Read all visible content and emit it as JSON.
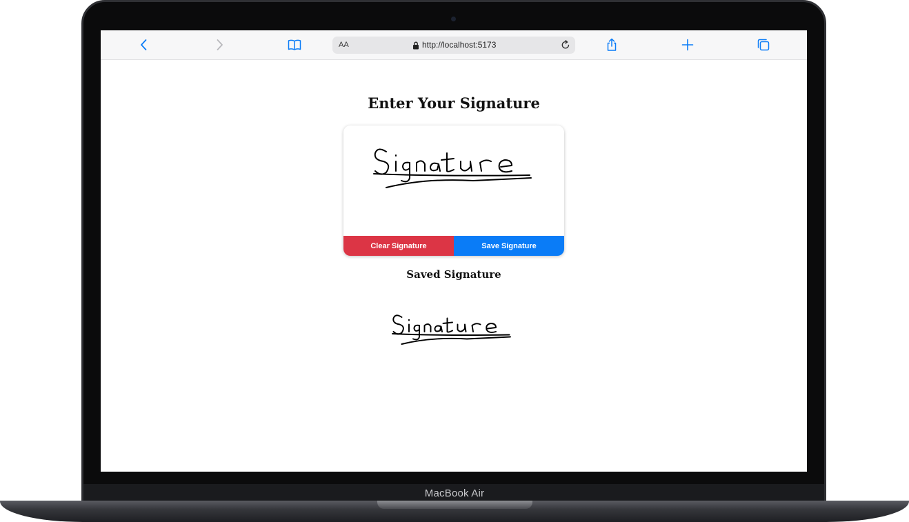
{
  "device": {
    "brand_label": "MacBook Air"
  },
  "browser": {
    "text_size_label": "AA",
    "url": "http://localhost:5173",
    "icons": {
      "back": "chevron-left-icon",
      "forward": "chevron-right-icon",
      "bookmarks": "book-icon",
      "lock": "lock-icon",
      "reload": "reload-icon",
      "share": "share-icon",
      "new_tab": "plus-icon",
      "tabs": "tabs-icon"
    },
    "accent_color": "#0a7cf7"
  },
  "page": {
    "title": "Enter Your Signature",
    "signature_pad": {
      "signature_text": "Signature",
      "clear_button": "Clear Signature",
      "save_button": "Save Signature",
      "clear_color": "#dc3545",
      "save_color": "#0a7cf7"
    },
    "saved_section": {
      "title": "Saved Signature",
      "signature_text": "Signature"
    }
  }
}
